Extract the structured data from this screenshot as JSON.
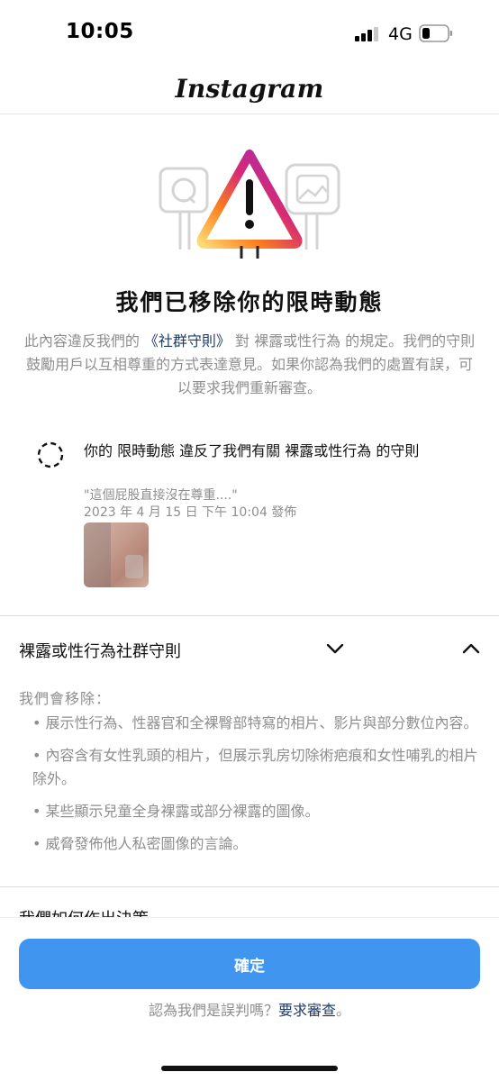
{
  "status_bar": {
    "time": "10:05",
    "network": "4G"
  },
  "header": {
    "logo": "Instagram"
  },
  "hero": {
    "headline": "我們已移除你的限時動態",
    "desc_before": "此內容違反我們的 ",
    "desc_link": "《社群守則》",
    "desc_after": " 對 裸露或性行為 的規定。我們的守則鼓勵用戶以互相尊重的方式表達意見。如果你認為我們的處置有誤，可以要求我們重新審查。"
  },
  "violation": {
    "title": "你的 限時動態 違反了我們有關 裸露或性行為 的守則",
    "quote": "\"這個屁股直接沒在尊重....\"",
    "date": "2023 年 4 月 15 日 下午 10:04 發佈"
  },
  "guidelines": {
    "title": "裸露或性行為社群守則",
    "remove_heading": "我們會移除：",
    "items": [
      "• 展示性行為、性器官和全裸臀部特寫的相片、影片與部分數位內容。",
      "• 內容含有女性乳頭的相片，但展示乳房切除術疤痕和女性哺乳的相片除外。",
      "• 某些顯示兒童全身裸露或部分裸露的圖像。",
      "• 威脅發佈他人私密圖像的言論。"
    ],
    "next_title": "我們如何作出決策"
  },
  "footer": {
    "ok_label": "確定",
    "appeal_text": "認為我們是誤判嗎？",
    "appeal_link": "要求審查",
    "appeal_end": "。"
  },
  "colors": {
    "accent": "#4096ef",
    "link": "#1d3a66",
    "muted": "#8e8e8e"
  }
}
